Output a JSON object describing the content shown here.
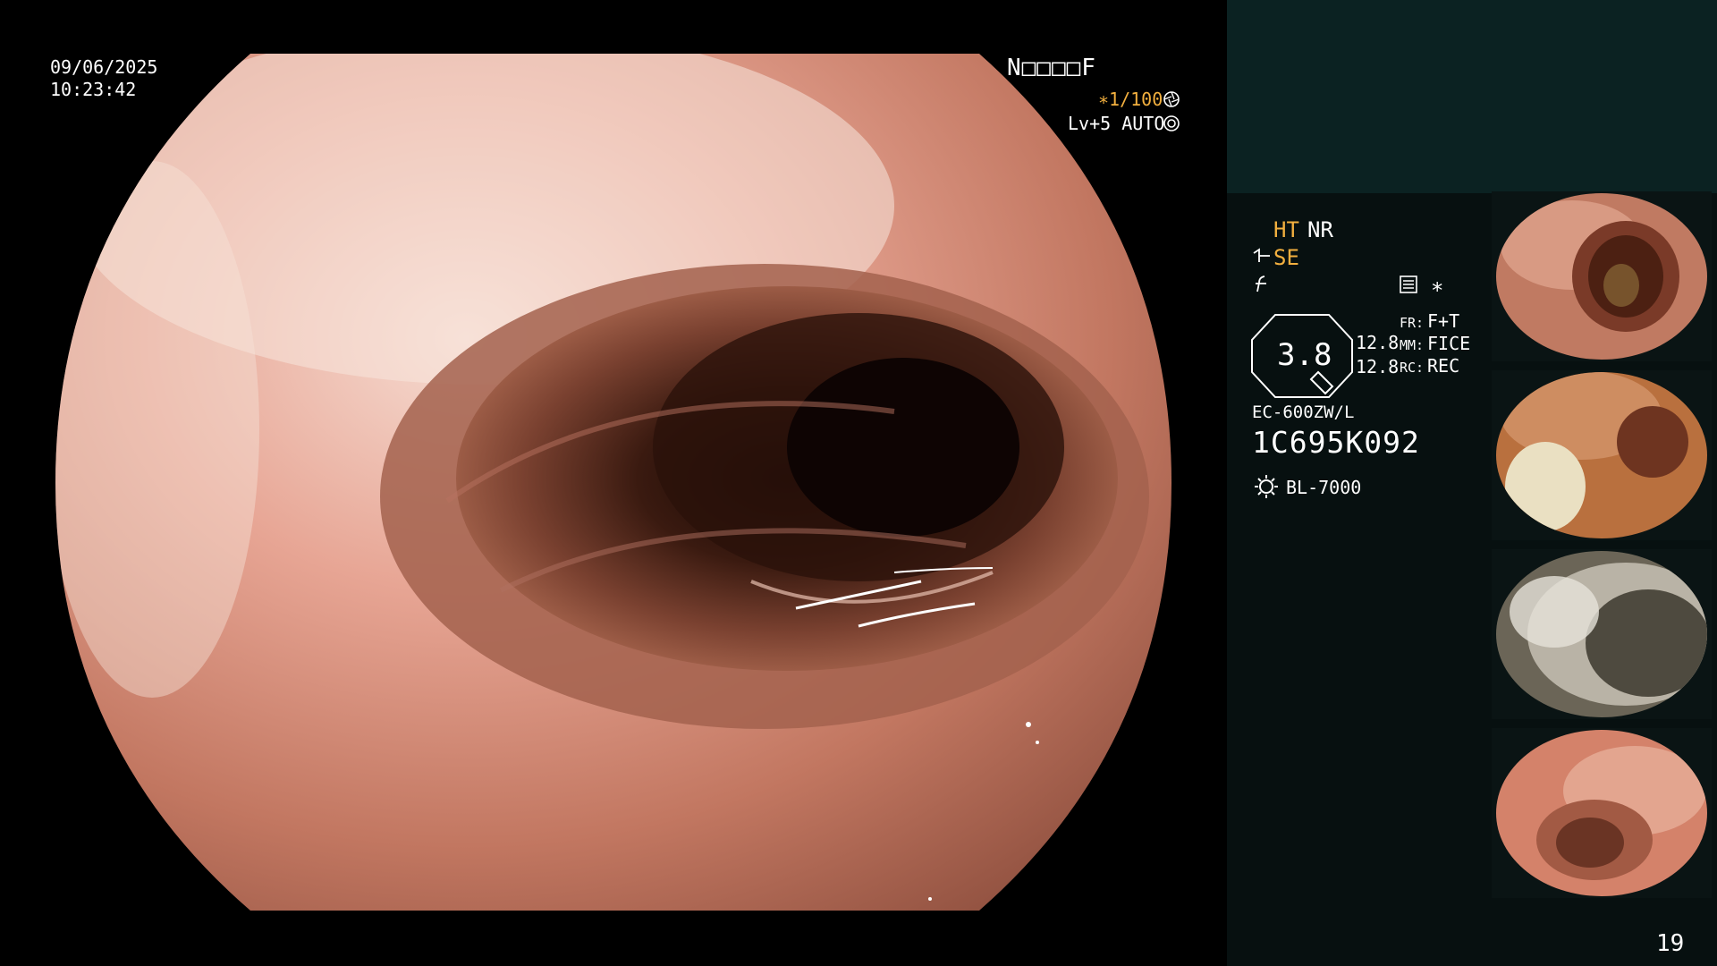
{
  "overlay": {
    "date": "09/06/2025",
    "time": "10:23:42",
    "patient_name": "N□□□□F",
    "shutter": "∗1/100",
    "level": "Lv+5 AUTO"
  },
  "side_panel": {
    "ht": "HT",
    "nr": "NR",
    "se": "SE",
    "asterisk": "∗",
    "gauge_value": "3.8",
    "values": [
      "12.8",
      "12.8"
    ],
    "fr_label": "FR:",
    "fr_value": "F+T",
    "mm_label": "MM:",
    "mm_value": "FICE",
    "rc_label": "RC:",
    "rc_value": "REC",
    "scope_model": "EC-600ZW/L",
    "scope_serial": "1C695K092",
    "light_source": "BL-7000",
    "page_number": "19"
  },
  "thumbnails": [
    {
      "label": "thumbnail-1",
      "serial": "1C695K092"
    },
    {
      "label": "thumbnail-2",
      "serial": "1C695K092"
    },
    {
      "label": "thumbnail-3",
      "serial": "1C695K092"
    },
    {
      "label": "thumbnail-4",
      "serial": "1C695K092"
    }
  ],
  "colors": {
    "accent": "#f3b03f",
    "panel_bg": "#071010",
    "panel_top_bg": "#0b2222"
  },
  "icons": [
    "shutter-icon",
    "auto-icon",
    "se-icon",
    "f-icon",
    "list-icon",
    "gauge-icon",
    "sun-icon"
  ]
}
